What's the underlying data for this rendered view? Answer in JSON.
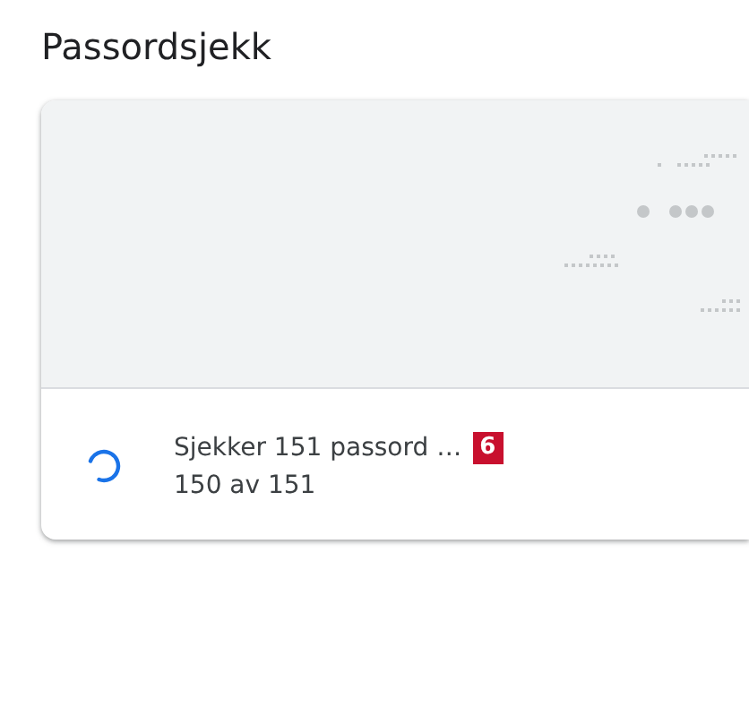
{
  "title": "Passordsjekk",
  "status": {
    "message": "Sjekker 151 passord …",
    "callout": "6",
    "progress": "150 av 151"
  }
}
